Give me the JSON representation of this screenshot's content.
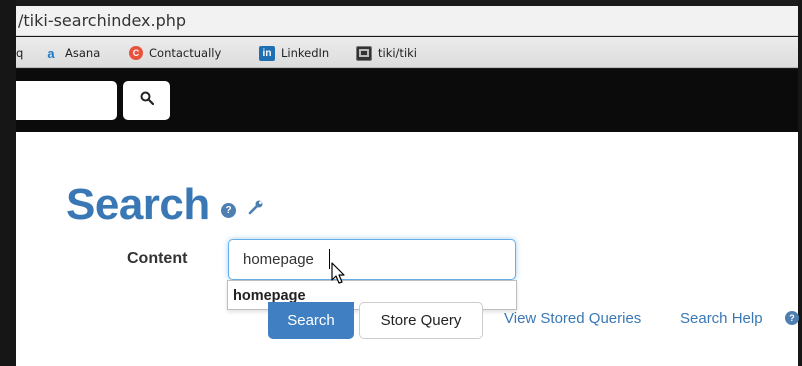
{
  "browser": {
    "url_text": "/tiki-searchindex.php",
    "bookmarks": [
      {
        "label": "q",
        "icon": "partial-icon"
      },
      {
        "label": "Asana",
        "icon": "asana-icon",
        "glyph": "a"
      },
      {
        "label": "Contactually",
        "icon": "contactually-icon",
        "glyph": "C"
      },
      {
        "label": "LinkedIn",
        "icon": "linkedin-icon",
        "glyph": "in"
      },
      {
        "label": "tiki/tiki",
        "icon": "tiki-icon"
      }
    ]
  },
  "navbar": {
    "search_value": "",
    "search_icon": "magnifier-icon"
  },
  "page": {
    "title": "Search",
    "help_glyph": "?",
    "content_label": "Content",
    "content_value": "homepage",
    "autocomplete": [
      "homepage"
    ],
    "search_button": "Search",
    "store_query_button": "Store Query",
    "view_stored_queries_link": "View Stored Queries",
    "search_help_link": "Search Help"
  },
  "colors": {
    "link_blue": "#3a78b5",
    "primary_button": "#3f7fc2",
    "navbar_bg": "#0b0b0b",
    "focus_border": "#66afe9"
  }
}
